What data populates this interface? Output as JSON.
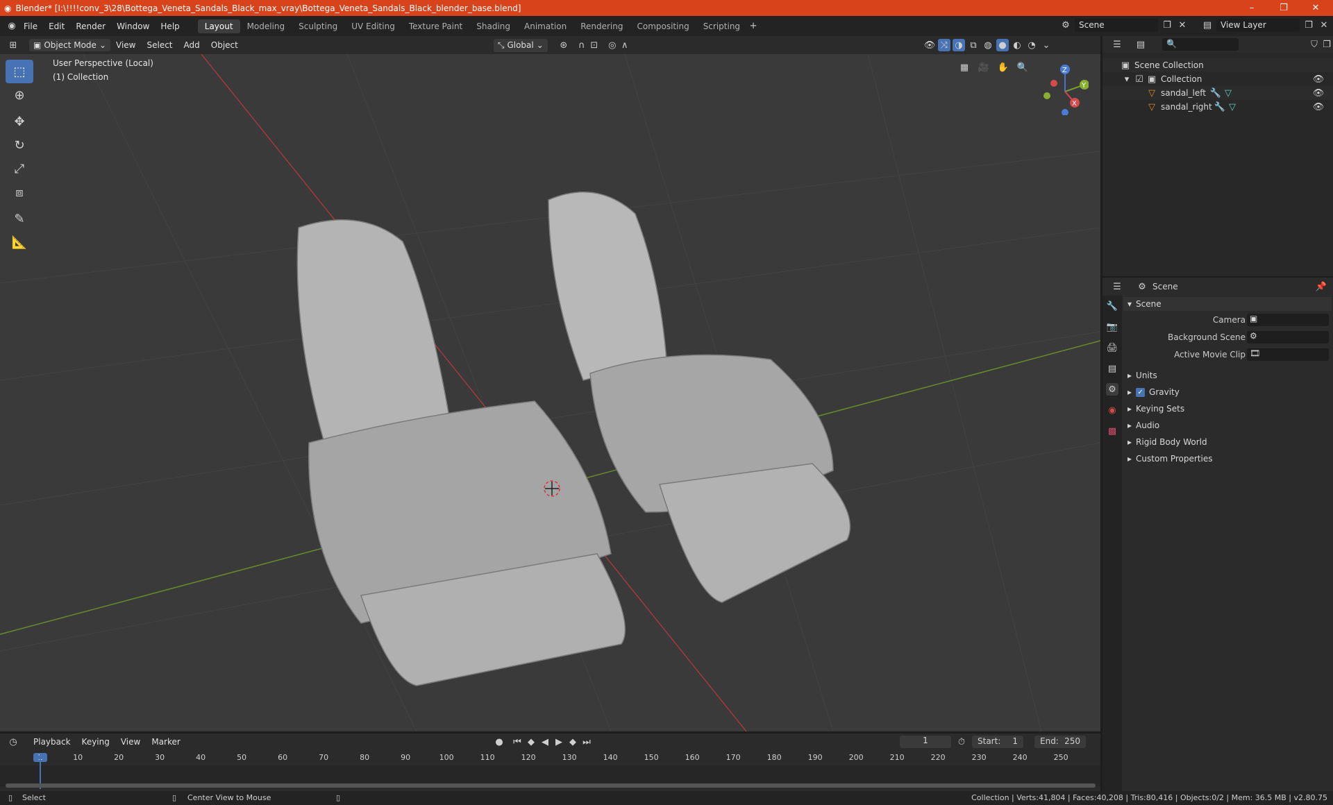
{
  "titlebar": {
    "title": "Blender* [I:\\!!!!conv_3\\28\\Bottega_Veneta_Sandals_Black_max_vray\\Bottega_Veneta_Sandals_Black_blender_base.blend]",
    "minimize": "–",
    "restore": "❐",
    "close": "✕"
  },
  "menu": [
    "File",
    "Edit",
    "Render",
    "Window",
    "Help"
  ],
  "workspaces": [
    "Layout",
    "Modeling",
    "Sculpting",
    "UV Editing",
    "Texture Paint",
    "Shading",
    "Animation",
    "Rendering",
    "Compositing",
    "Scripting"
  ],
  "scene_selector": {
    "value": "Scene"
  },
  "view_layer": {
    "value": "View Layer"
  },
  "viewport_header": {
    "mode": "Object Mode",
    "view": "View",
    "select": "Select",
    "add": "Add",
    "object": "Object",
    "transform": "Global"
  },
  "viewport": {
    "perspective": "User Perspective (Local)",
    "collection": "(1) Collection",
    "gizmo": {
      "z": "Z",
      "y": "Y",
      "x": "X"
    }
  },
  "outliner": {
    "root": "Scene Collection",
    "collection": "Collection",
    "objects": [
      "sandal_left",
      "sandal_right"
    ]
  },
  "properties": {
    "header": "Scene",
    "panel": "Scene",
    "camera_label": "Camera",
    "bg_label": "Background Scene",
    "clip_label": "Active Movie Clip",
    "sections": [
      "Units",
      "Gravity",
      "Keying Sets",
      "Audio",
      "Rigid Body World",
      "Custom Properties"
    ],
    "gravity_checked": true
  },
  "timeline": {
    "playback": "Playback",
    "keying": "Keying",
    "view": "View",
    "marker": "Marker",
    "current_frame": "1",
    "start_label": "Start:",
    "start": "1",
    "end_label": "End:",
    "end": "250",
    "ticks": [
      "1",
      "10",
      "20",
      "30",
      "40",
      "50",
      "60",
      "70",
      "80",
      "90",
      "100",
      "110",
      "120",
      "130",
      "140",
      "150",
      "160",
      "170",
      "180",
      "190",
      "200",
      "210",
      "220",
      "230",
      "240",
      "250"
    ]
  },
  "statusbar": {
    "select": "Select",
    "center": "Center View to Mouse",
    "stats": "Collection | Verts:41,804 | Faces:40,208 | Tris:80,416 | Objects:0/2 | Mem: 36.5 MB | v2.80.75"
  },
  "colors": {
    "accent": "#4772b3",
    "title": "#d9431b"
  }
}
